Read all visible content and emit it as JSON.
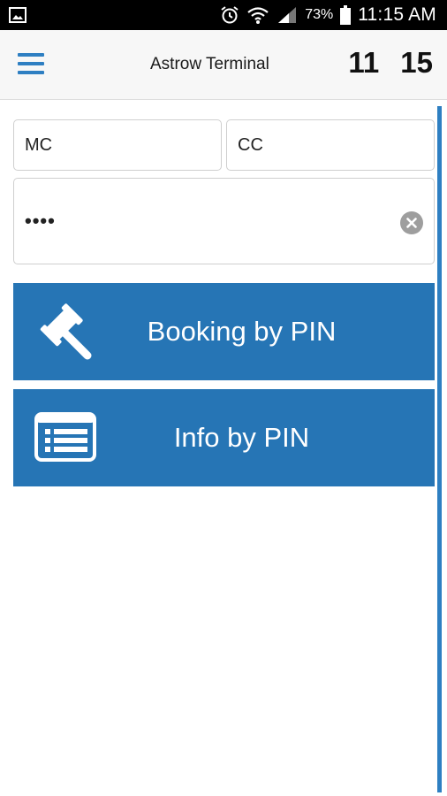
{
  "status_bar": {
    "battery_percent": "73%",
    "time": "11:15 AM",
    "icons": [
      "image-icon",
      "alarm-icon",
      "wifi-icon",
      "signal-icon",
      "battery-icon"
    ]
  },
  "header": {
    "title": "Astrow Terminal",
    "clock_hours": "11",
    "clock_minutes": "15",
    "menu_icon": "hamburger-menu-icon"
  },
  "form": {
    "mc_value": "MC",
    "cc_value": "CC",
    "pin_value": "••••"
  },
  "actions": {
    "booking_label": "Booking by PIN",
    "booking_icon": "gavel-icon",
    "info_label": "Info by PIN",
    "info_icon": "list-card-icon"
  },
  "colors": {
    "accent": "#2675b5",
    "menu": "#2e7fc2",
    "status_bar": "#000000"
  }
}
